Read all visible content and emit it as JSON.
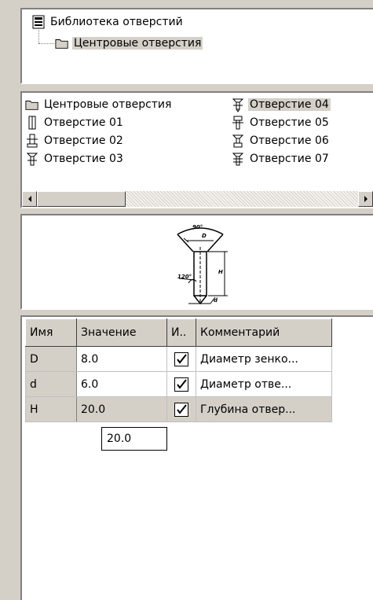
{
  "tree": {
    "root": {
      "label": "Библиотека отверстий",
      "icon": "library-icon"
    },
    "child": {
      "label": "Центровые отверстия",
      "icon": "folder-icon"
    }
  },
  "list": {
    "items": [
      {
        "label": "Центровые отверстия",
        "icon": "folder-icon"
      },
      {
        "label": "Отверстие 01",
        "icon": "hole-01-icon"
      },
      {
        "label": "Отверстие 02",
        "icon": "hole-02-icon"
      },
      {
        "label": "Отверстие 03",
        "icon": "hole-03-icon"
      },
      {
        "label": "Отверстие 04",
        "icon": "hole-04-icon",
        "selected": true
      },
      {
        "label": "Отверстие 05",
        "icon": "hole-05-icon"
      },
      {
        "label": "Отверстие 06",
        "icon": "hole-06-icon"
      },
      {
        "label": "Отверстие 07",
        "icon": "hole-07-icon"
      }
    ]
  },
  "preview": {
    "dims": {
      "angle_top": "90°",
      "D": "D",
      "angle_left": "120°",
      "H": "H",
      "d": "d"
    }
  },
  "params": {
    "columns": [
      "Имя",
      "Значение",
      "И..",
      "Комментарий"
    ],
    "rows": [
      {
        "name": "D",
        "value": "8.0",
        "checked": true,
        "comment": "Диаметр зенко..."
      },
      {
        "name": "d",
        "value": "6.0",
        "checked": true,
        "comment": "Диаметр отве..."
      },
      {
        "name": "H",
        "value": "20.0",
        "checked": true,
        "comment": "Глубина отвер...",
        "active": true
      }
    ],
    "editor_value": "20.0"
  }
}
